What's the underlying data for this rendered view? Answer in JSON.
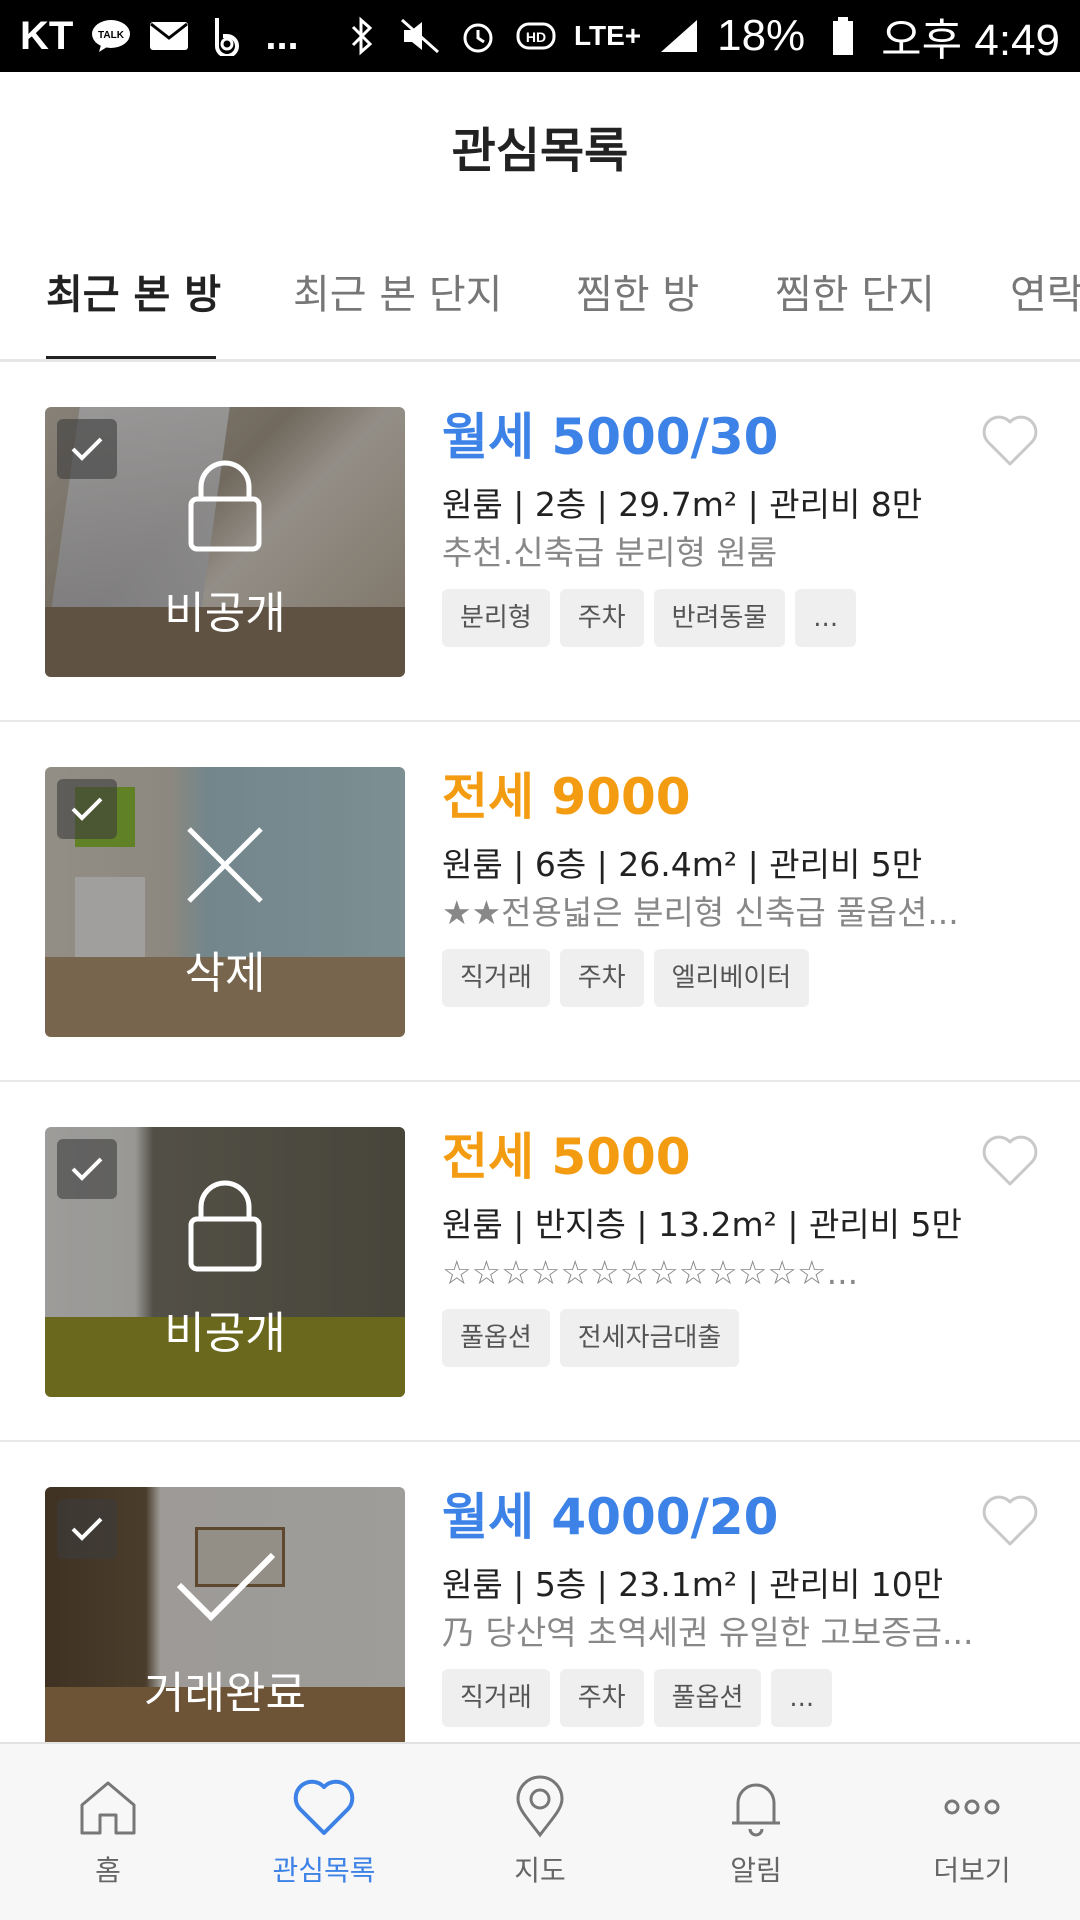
{
  "status_bar": {
    "carrier": "KT",
    "dots": "...",
    "network": "LTE+",
    "battery": "18%",
    "time": "오후 4:49"
  },
  "header": {
    "title": "관심목록"
  },
  "tabs": [
    {
      "label": "최근 본 방",
      "active": true
    },
    {
      "label": "최근 본 단지",
      "active": false
    },
    {
      "label": "찜한 방",
      "active": false
    },
    {
      "label": "찜한 단지",
      "active": false
    },
    {
      "label": "연락",
      "active": false
    }
  ],
  "listings": [
    {
      "price": "월세 5000/30",
      "price_type": "monthly",
      "spec": "원룸 | 2층 | 29.7m² | 관리비 8만",
      "description": "추천.신축급 분리형 원룸",
      "tags": [
        "분리형",
        "주차",
        "반려동물",
        "..."
      ],
      "status": "비공개",
      "status_icon": "lock-icon",
      "favorite": false
    },
    {
      "price": "전세 9000",
      "price_type": "jeonse",
      "spec": "원룸 | 6층 | 26.4m² | 관리비 5만",
      "description": "★★전용넓은 분리형 신축급 풀옵션...",
      "tags": [
        "직거래",
        "주차",
        "엘리베이터"
      ],
      "status": "삭제",
      "status_icon": "x-icon",
      "favorite": null
    },
    {
      "price": "전세 5000",
      "price_type": "jeonse",
      "spec": "원룸 | 반지층 | 13.2m² | 관리비 5만",
      "description": "☆☆☆☆☆☆☆☆☆☆☆☆☆...",
      "tags": [
        "풀옵션",
        "전세자금대출"
      ],
      "status": "비공개",
      "status_icon": "lock-icon",
      "favorite": false
    },
    {
      "price": "월세 4000/20",
      "price_type": "monthly",
      "spec": "원룸 | 5층 | 23.1m² | 관리비 10만",
      "description": "乃 당산역 초역세권 유일한 고보증금...",
      "tags": [
        "직거래",
        "주차",
        "풀옵션",
        "..."
      ],
      "status": "거래완료",
      "status_icon": "checkmark-icon",
      "favorite": false
    }
  ],
  "bottom_nav": [
    {
      "label": "홈",
      "icon": "home-icon",
      "active": false
    },
    {
      "label": "관심목록",
      "icon": "heart-icon",
      "active": true
    },
    {
      "label": "지도",
      "icon": "map-pin-icon",
      "active": false
    },
    {
      "label": "알림",
      "icon": "bell-icon",
      "active": false
    },
    {
      "label": "더보기",
      "icon": "more-icon",
      "active": false
    }
  ],
  "colors": {
    "monthly": "#3d82e6",
    "jeonse": "#f39c12",
    "active_nav": "#3d82e6"
  }
}
